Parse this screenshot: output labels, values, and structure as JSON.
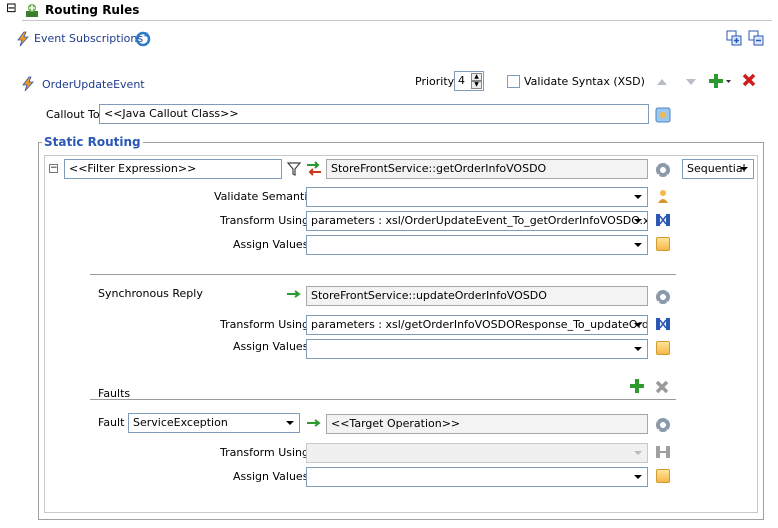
{
  "header": {
    "title": "Routing Rules",
    "collapse_glyph": "⊟"
  },
  "event_subscriptions": {
    "label": "Event Subscriptions"
  },
  "rule": {
    "event_name": "OrderUpdateEvent",
    "priority_label": "Priority",
    "priority_value": "4",
    "validate_syntax_label": "Validate Syntax (XSD)",
    "validate_syntax_checked": false
  },
  "callout": {
    "label": "Callout To",
    "value": "<<Java Callout Class>>"
  },
  "static_routing": {
    "title": "Static Routing",
    "filter_expression": "<<Filter Expression>>",
    "target_operation": "StoreFrontService::getOrderInfoVOSDO",
    "execution_mode": "Sequential",
    "validate_semantic": {
      "label": "Validate Semantic",
      "value": ""
    },
    "transform": {
      "label": "Transform Using",
      "value": "parameters : xsl/OrderUpdateEvent_To_getOrderInfoVOSDO.xsl"
    },
    "assign": {
      "label": "Assign Values",
      "value": ""
    }
  },
  "sync_reply": {
    "label": "Synchronous Reply",
    "target": "StoreFrontService::updateOrderInfoVOSDO",
    "transform": {
      "label": "Transform Using",
      "value": "parameters : xsl/getOrderInfoVOSDOResponse_To_updateOrd..."
    },
    "assign": {
      "label": "Assign Values",
      "value": ""
    }
  },
  "faults": {
    "title": "Faults",
    "fault_label": "Fault",
    "fault_value": "ServiceException",
    "target": "<<Target Operation>>",
    "transform": {
      "label": "Transform Using",
      "value": ""
    },
    "assign": {
      "label": "Assign Values",
      "value": ""
    }
  },
  "colors": {
    "accent_blue": "#2b57b5",
    "add_green": "#2c9a2c",
    "delete_red": "#d01c1c",
    "border": "#a0a0a0"
  }
}
